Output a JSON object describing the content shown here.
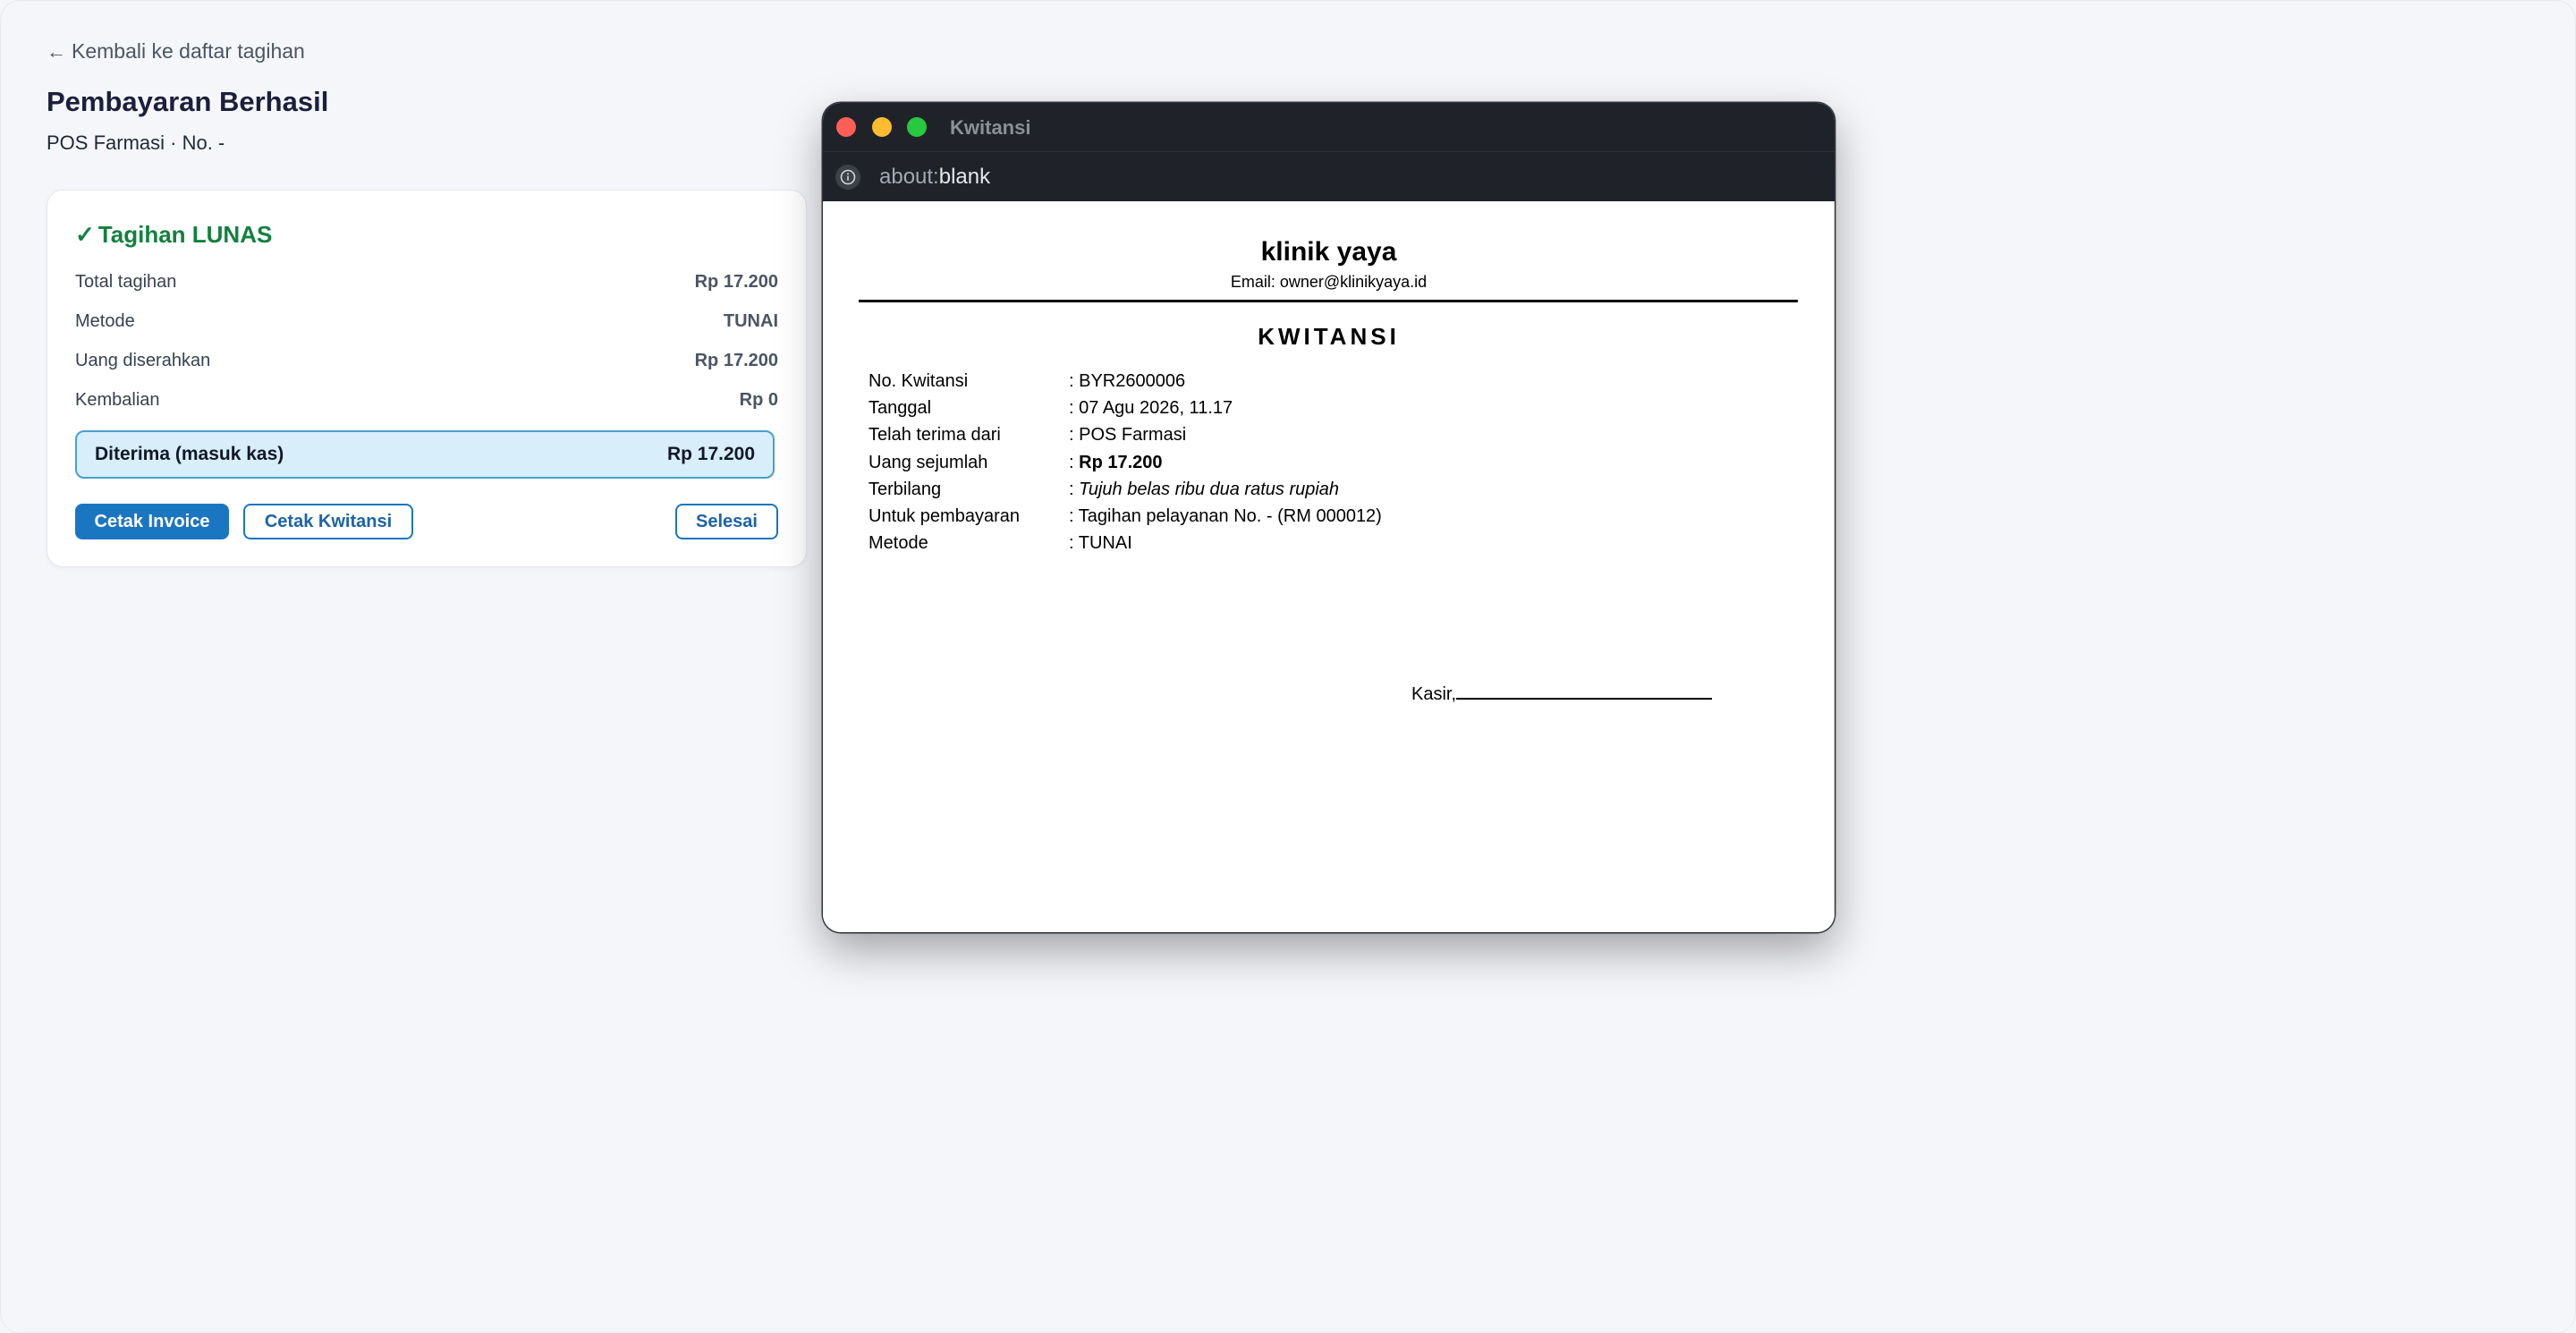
{
  "app": {
    "back_link": "Kembali ke daftar tagihan",
    "title": "Pembayaran Berhasil",
    "subtitle": "POS Farmasi · No. -"
  },
  "summary": {
    "status_title": "Tagihan LUNAS",
    "rows": [
      {
        "label": "Total tagihan",
        "value": "Rp 17.200"
      },
      {
        "label": "Metode",
        "value": "TUNAI"
      },
      {
        "label": "Uang diserahkan",
        "value": "Rp 17.200"
      },
      {
        "label": "Kembalian",
        "value": "Rp 0"
      }
    ],
    "received_label": "Diterima (masuk kas)",
    "received_value": "Rp 17.200",
    "buttons": {
      "invoice": "Cetak Invoice",
      "kwitansi": "Cetak Kwitansi",
      "selesai": "Selesai"
    }
  },
  "popup": {
    "window_title": "Kwitansi",
    "url_scheme": "about:",
    "url_path": "blank",
    "receipt": {
      "clinic_name": "klinik yaya",
      "email": "Email: owner@klinikyaya.id",
      "title": "KWITANSI",
      "rows": [
        {
          "label": "No. Kwitansi",
          "value": ": BYR2600006"
        },
        {
          "label": "Tanggal",
          "value": ": 07 Agu 2026, 11.17"
        },
        {
          "label": "Telah terima dari",
          "value": ": POS Farmasi"
        },
        {
          "label": "Uang sejumlah",
          "prefix": ": ",
          "value": "Rp 17.200"
        },
        {
          "label": "Terbilang",
          "prefix": ": ",
          "value": "Tujuh belas ribu dua ratus rupiah"
        },
        {
          "label": "Untuk pembayaran",
          "value": ": Tagihan pelayanan No. - (RM 000012)"
        },
        {
          "label": "Metode",
          "value": ": TUNAI"
        }
      ],
      "signature_label": "Kasir,"
    }
  },
  "colors": {
    "success": "#12813e",
    "primary": "#1b76c2",
    "received_bg": "#d8eefa"
  }
}
